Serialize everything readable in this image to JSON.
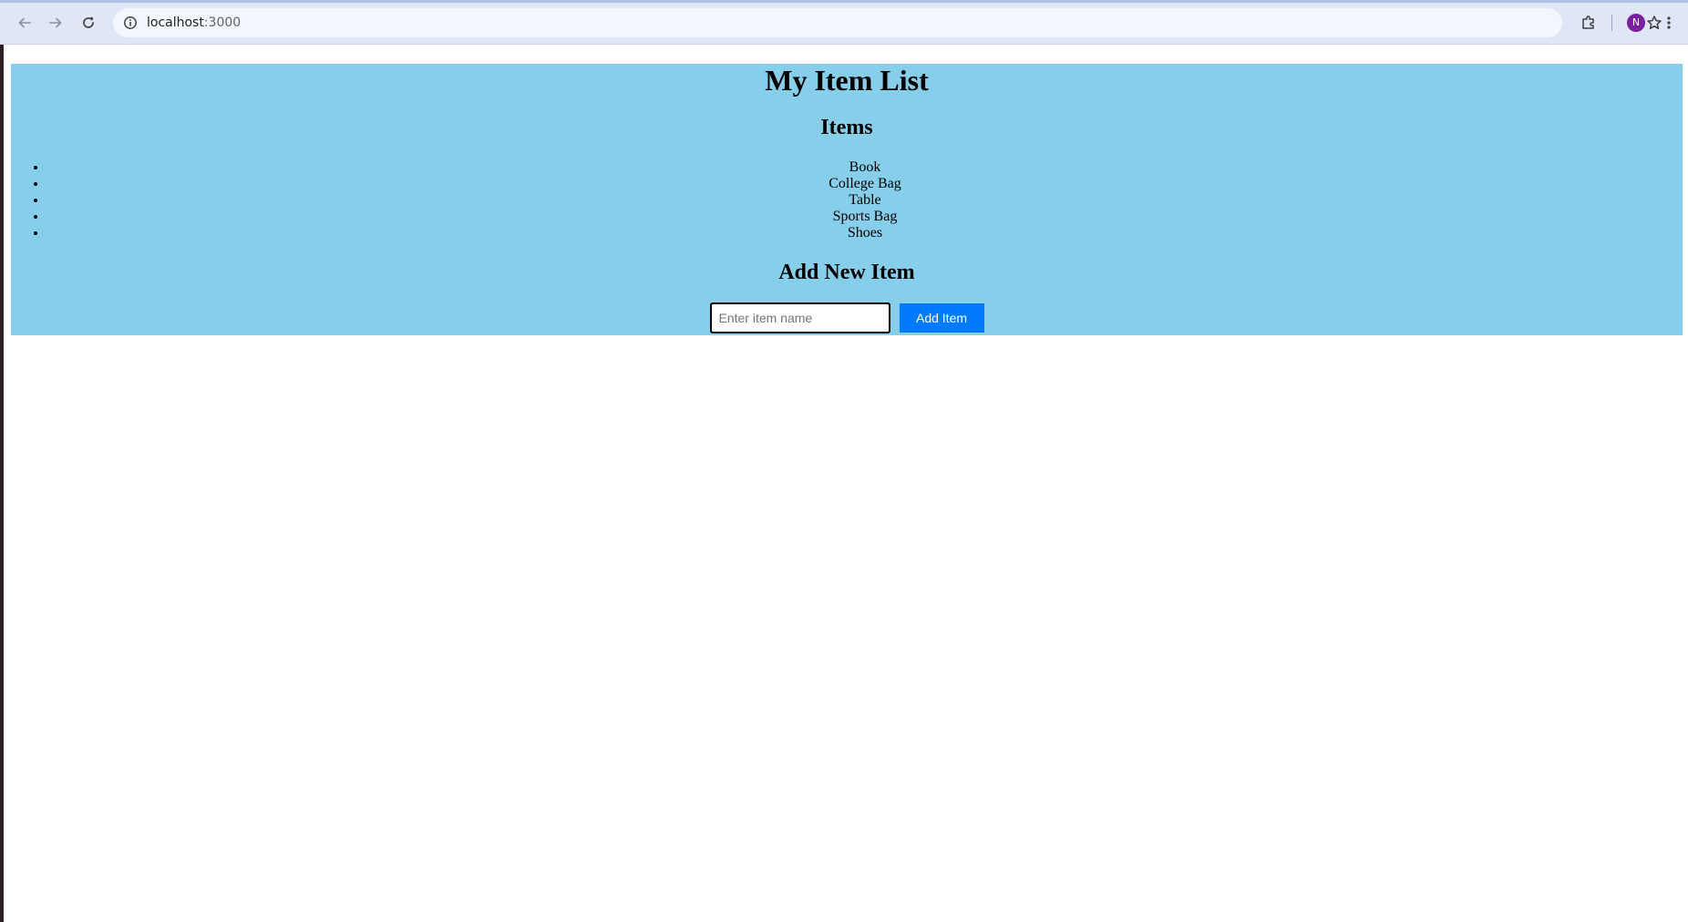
{
  "browser": {
    "url_host": "localhost",
    "url_port": ":3000",
    "avatar_letter": "N",
    "icons": [
      "back-arrow-icon",
      "forward-arrow-icon",
      "reload-icon",
      "site-info-icon",
      "bookmark-star-icon",
      "extensions-icon",
      "kebab-menu-icon"
    ]
  },
  "page": {
    "title": "My Item List",
    "items_heading": "Items",
    "items": [
      "Book",
      "College Bag",
      "Table",
      "Sports Bag",
      "Shoes"
    ],
    "add_heading": "Add New Item",
    "input_placeholder": "Enter item name",
    "input_value": "",
    "add_button_label": "Add Item"
  },
  "colors": {
    "app_background": "#87ceeb",
    "button_background": "#007bff",
    "avatar_background": "#7b1fa2"
  }
}
